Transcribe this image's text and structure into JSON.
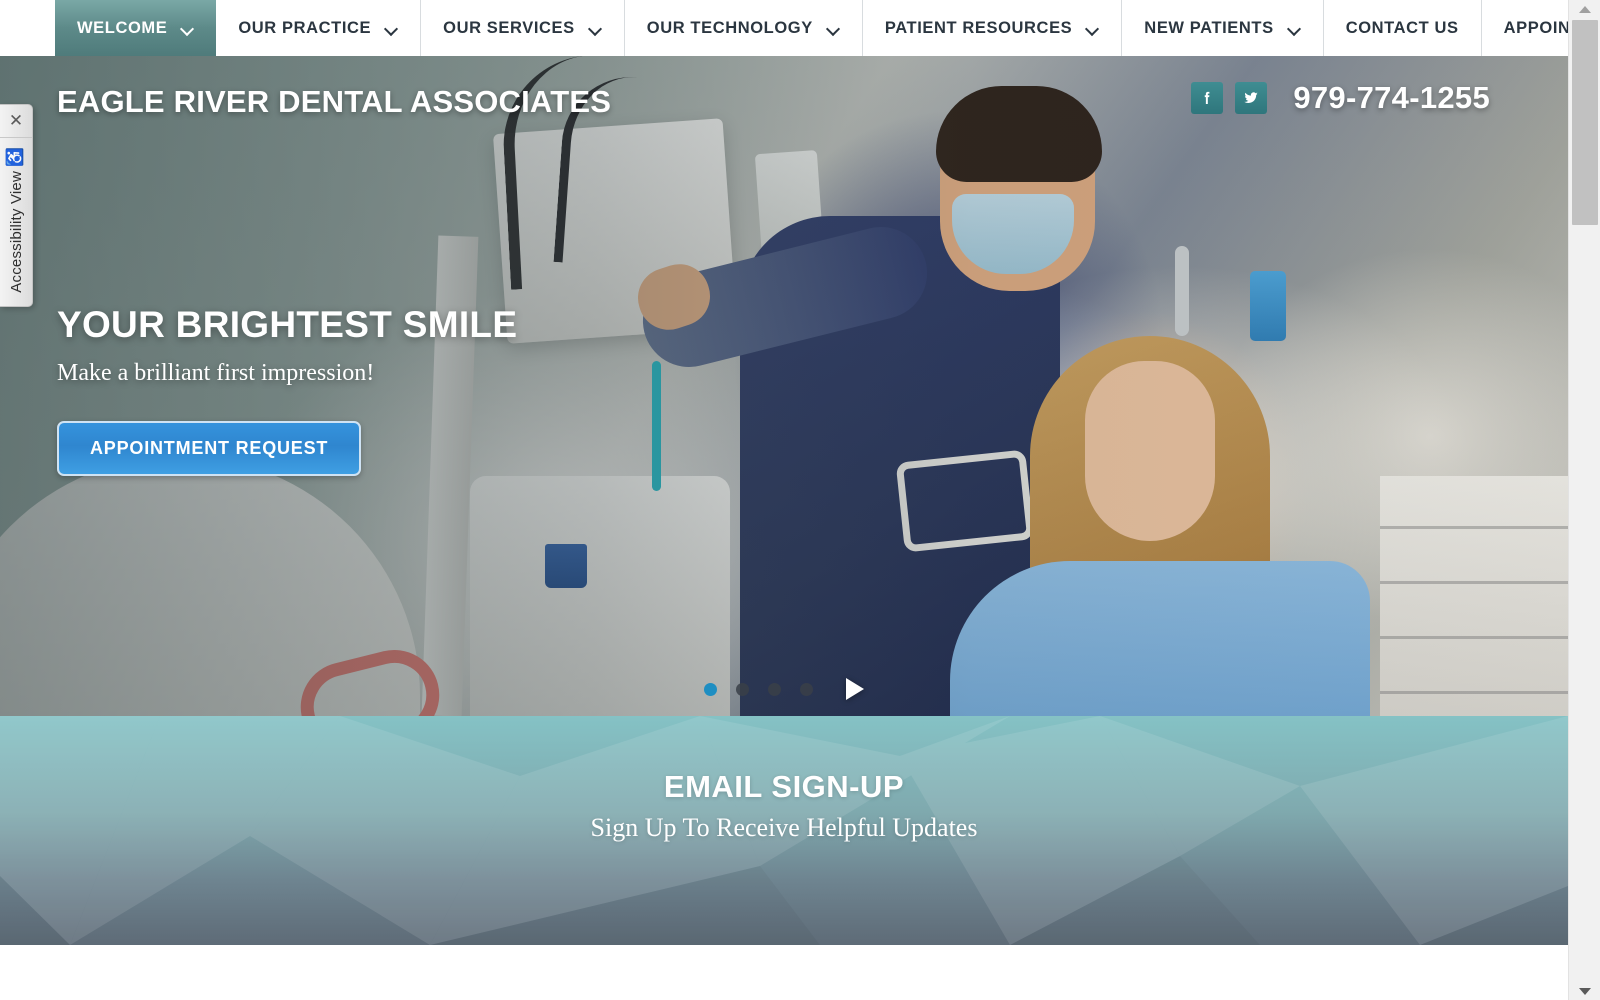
{
  "nav": {
    "items": [
      {
        "label": "WELCOME",
        "has_caret": true,
        "active": true
      },
      {
        "label": "OUR PRACTICE",
        "has_caret": true,
        "active": false
      },
      {
        "label": "OUR SERVICES",
        "has_caret": true,
        "active": false
      },
      {
        "label": "OUR TECHNOLOGY",
        "has_caret": true,
        "active": false
      },
      {
        "label": "PATIENT RESOURCES",
        "has_caret": true,
        "active": false
      },
      {
        "label": "NEW PATIENTS",
        "has_caret": true,
        "active": false
      },
      {
        "label": "CONTACT US",
        "has_caret": false,
        "active": false
      },
      {
        "label": "APPOINTMENT REQUEST",
        "has_caret": false,
        "active": false
      }
    ]
  },
  "hero": {
    "site_title": "EAGLE RIVER DENTAL ASSOCIATES",
    "phone": "979-774-1255",
    "social": [
      {
        "name": "facebook",
        "glyph": "f"
      },
      {
        "name": "twitter",
        "glyph": "t"
      }
    ],
    "headline": "YOUR BRIGHTEST SMILE",
    "subhead": "Make a brilliant first impression!",
    "cta_label": "APPOINTMENT REQUEST",
    "carousel": {
      "slide_count": 4,
      "active_slide": 1,
      "play_label": "play"
    }
  },
  "email_signup": {
    "title": "EMAIL SIGN-UP",
    "subtitle": "Sign Up To Receive Helpful Updates"
  },
  "accessibility_widget": {
    "label": "Accessibility View",
    "icon": "wheelchair-icon",
    "close_glyph": "✕"
  },
  "colors": {
    "nav_active": "#5d8a89",
    "social_tile": "#3f8d92",
    "cta_blue": "#3593dd",
    "dot_active": "#1e8ec2",
    "email_top": "#85c2c5",
    "email_bottom": "#5e6b77",
    "nav_text": "#2b3640"
  }
}
